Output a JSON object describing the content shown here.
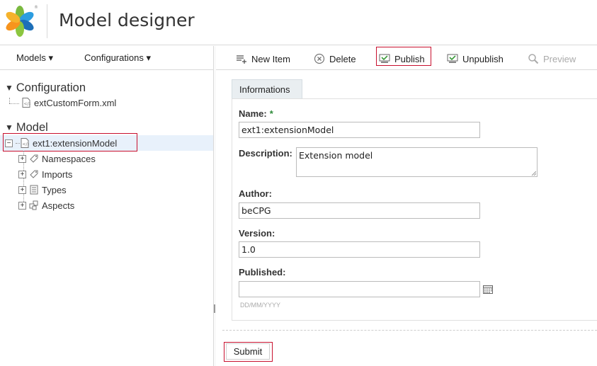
{
  "header": {
    "title": "Model designer",
    "logo_icon": "alfresco-flower-logo"
  },
  "left_menu": {
    "models_label": "Models ▾",
    "configurations_label": "Configurations ▾"
  },
  "tree": {
    "configuration_heading": "Configuration",
    "configuration_items": [
      {
        "label": "extCustomForm.xml",
        "icon": "xml-file-icon"
      }
    ],
    "model_heading": "Model",
    "model_root": {
      "label": "ext1:extensionModel",
      "icon": "xml-file-icon",
      "selected": true
    },
    "model_children": [
      {
        "label": "Namespaces",
        "icon": "tag-icon"
      },
      {
        "label": "Imports",
        "icon": "tag-icon"
      },
      {
        "label": "Types",
        "icon": "list-icon"
      },
      {
        "label": "Aspects",
        "icon": "aspects-icon"
      }
    ]
  },
  "toolbar": {
    "new_item": "New Item",
    "delete": "Delete",
    "publish": "Publish",
    "unpublish": "Unpublish",
    "preview": "Preview"
  },
  "form": {
    "tab_label": "Informations",
    "name_label": "Name:",
    "required_mark": "*",
    "name_value": "ext1:extensionModel",
    "description_label": "Description:",
    "description_value": "Extension model",
    "author_label": "Author:",
    "author_value": "beCPG",
    "version_label": "Version:",
    "version_value": "1.0",
    "published_label": "Published:",
    "published_value": "",
    "date_hint": "DD/MM/YYYY",
    "submit_label": "Submit"
  },
  "colors": {
    "highlight_red": "#c8102e",
    "required_green": "#2e8b3a",
    "selected_row": "#e8f1fb"
  }
}
